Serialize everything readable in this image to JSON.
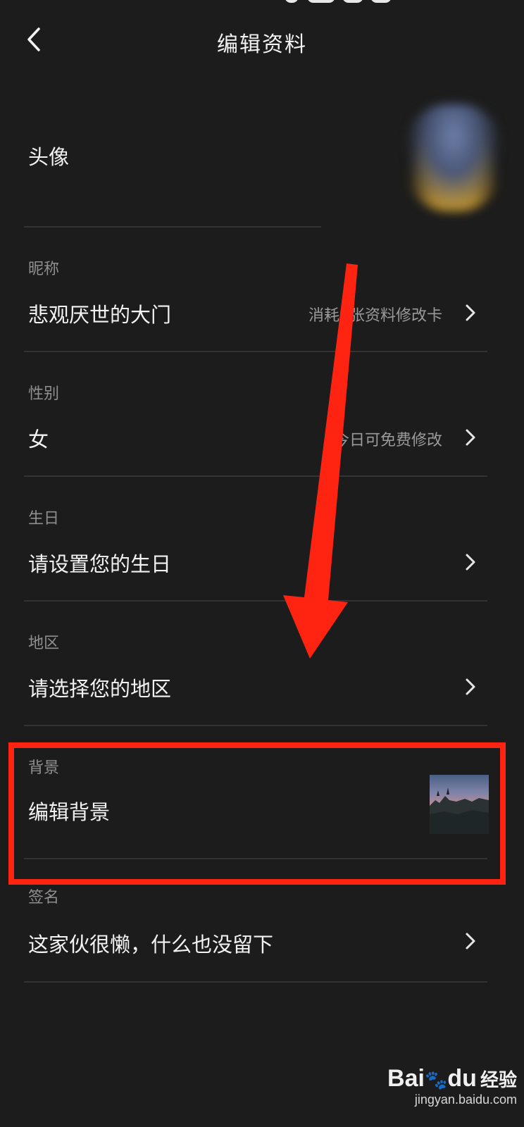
{
  "header": {
    "title": "编辑资料"
  },
  "avatar": {
    "label": "头像"
  },
  "fields": {
    "nickname": {
      "section": "昵称",
      "value": "悲观厌世的大门",
      "hint": "消耗1张资料修改卡"
    },
    "gender": {
      "section": "性别",
      "value": "女",
      "hint": "今日可免费修改"
    },
    "birthday": {
      "section": "生日",
      "value": "请设置您的生日"
    },
    "region": {
      "section": "地区",
      "value": "请选择您的地区"
    },
    "background": {
      "section": "背景",
      "value": "编辑背景"
    },
    "signature": {
      "section": "签名",
      "value": "这家伙很懒，什么也没留下"
    }
  },
  "annotation": {
    "arrow_color": "#ff2412",
    "box_color": "#ff2412"
  },
  "watermark": {
    "logo": "Bai",
    "logo2": "du",
    "brand": "经验",
    "url": "jingyan.baidu.com"
  }
}
